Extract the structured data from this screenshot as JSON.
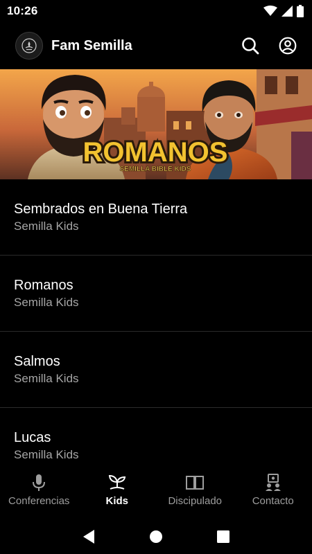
{
  "status": {
    "time": "10:26"
  },
  "app": {
    "title": "Fam Semilla"
  },
  "banner": {
    "title": "ROMANOS",
    "subtitle": "SEMILLA BIBLE KIDS"
  },
  "items": [
    {
      "title": "Sembrados en Buena Tierra",
      "subtitle": "Semilla Kids"
    },
    {
      "title": "Romanos",
      "subtitle": "Semilla Kids"
    },
    {
      "title": "Salmos",
      "subtitle": "Semilla Kids"
    },
    {
      "title": "Lucas",
      "subtitle": "Semilla Kids"
    }
  ],
  "nav": [
    {
      "label": "Conferencias",
      "icon": "microphone-icon",
      "active": false
    },
    {
      "label": "Kids",
      "icon": "sprout-icon",
      "active": true
    },
    {
      "label": "Discipulado",
      "icon": "book-icon",
      "active": false
    },
    {
      "label": "Contacto",
      "icon": "contact-icon",
      "active": false
    }
  ],
  "colors": {
    "background": "#000000",
    "secondary_text": "#a6a6a6",
    "banner_title": "#f2c230"
  }
}
